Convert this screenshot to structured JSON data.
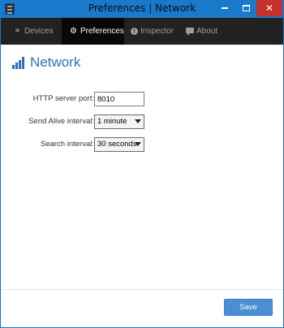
{
  "window": {
    "title": "Preferences | Network",
    "close_glyph": "✕"
  },
  "navbar": {
    "items": [
      {
        "label": "Devices",
        "icon": "link-icon",
        "active": false
      },
      {
        "label": "Preferences",
        "icon": "gear-icon",
        "active": true
      },
      {
        "label": "Inspector",
        "icon": "info-icon",
        "active": false
      },
      {
        "label": "About",
        "icon": "chat-icon",
        "active": false
      }
    ],
    "glyphs": {
      "link": "⚭",
      "gear": "⚙",
      "info": "i"
    }
  },
  "page": {
    "title": "Network",
    "icon": "signal-icon",
    "accent_color": "#2e71b8"
  },
  "form": {
    "http_port": {
      "label": "HTTP server port:",
      "value": "8010"
    },
    "send_alive": {
      "label": "Send Alive interval:",
      "value": "1 minute"
    },
    "search": {
      "label": "Search interval:",
      "value": "30 seconds"
    }
  },
  "footer": {
    "save_label": "Save"
  }
}
